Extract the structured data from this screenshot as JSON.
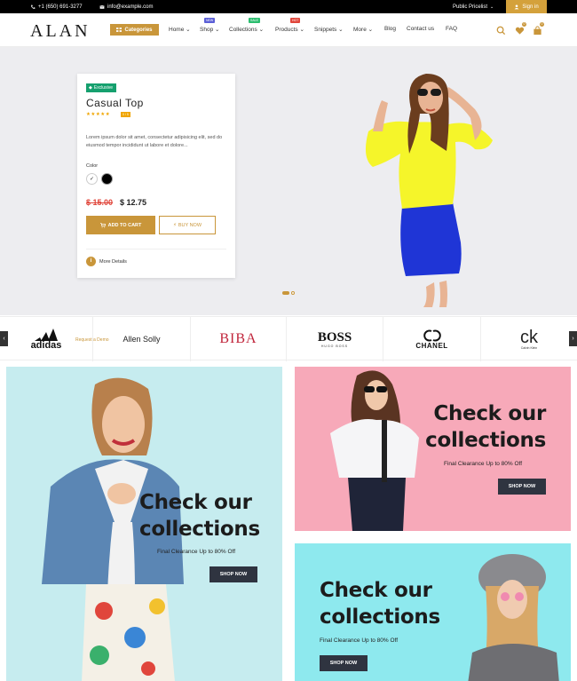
{
  "topbar": {
    "phone": "+1 (650) 691-3277",
    "email": "info@example.com",
    "pricelist": "Public Pricelist",
    "signin": "Sign in"
  },
  "nav": {
    "logo": "ALAN",
    "categories": "Categories",
    "menu": [
      {
        "label": "Home",
        "caret": true
      },
      {
        "label": "Shop",
        "caret": true,
        "tag": "NEW",
        "tag_color": "#5b5fd6"
      },
      {
        "label": "Collections",
        "caret": true,
        "tag": "SALE",
        "tag_color": "#2bbd6e"
      },
      {
        "label": "Products",
        "caret": true,
        "tag": "HOT",
        "tag_color": "#e0453a"
      },
      {
        "label": "Snippets",
        "caret": true
      },
      {
        "label": "More",
        "caret": true
      },
      {
        "label": "Blog",
        "caret": false
      },
      {
        "label": "Contact us",
        "caret": false
      },
      {
        "label": "FAQ",
        "caret": false
      }
    ],
    "wishlist_count": "0",
    "cart_count": "0",
    "accent": "#c9963a"
  },
  "hero": {
    "badge": "Exclusive",
    "title": "Casual Top",
    "stars": "★★★★★",
    "rating_count": "0 / 5",
    "description": "Lorem ipsum dolor sit amet, consectetur adipisicing elit, sed do eiusmod tempor incididunt ut labore et dolore...",
    "color_label": "Color",
    "price_old": "$ 15.00",
    "price_new": "$ 12.75",
    "add_to_cart": "ADD TO CART",
    "buy_now": "BUY NOW",
    "more_details": "More Details"
  },
  "brands": [
    "adidas",
    "Request a Demo",
    "Allen Solly",
    "BIBA",
    "BOSS",
    "HUGO BOSS",
    "CHANEL",
    "ck",
    "Calvin Klein"
  ],
  "banners": [
    {
      "heading_1": "Check our",
      "heading_2": "collections",
      "subtitle": "Final Clearance Up to 80% Off",
      "button": "SHOP NOW",
      "bg": "#c6ecef"
    },
    {
      "heading_1": "Check our",
      "heading_2": "collections",
      "subtitle": "Final Clearance Up to 80% Off",
      "button": "SHOP NOW",
      "bg": "#f7a9b9"
    },
    {
      "heading_1": "Check our",
      "heading_2": "collections",
      "subtitle": "Final Clearance Up to 80% Off",
      "button": "SHOP NOW",
      "bg": "#8ee9ee"
    }
  ]
}
